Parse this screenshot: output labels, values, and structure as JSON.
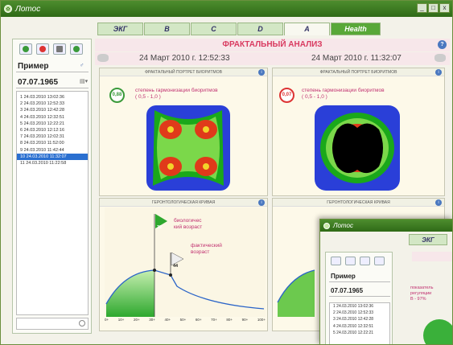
{
  "window": {
    "title": "Лотос",
    "minimize": "_",
    "maximize": "□",
    "close": "x"
  },
  "tabs": [
    "ЭКГ",
    "В",
    "С",
    "D",
    "А",
    "Health"
  ],
  "left": {
    "patient": "Пример",
    "dob": "07.07.1965",
    "records": [
      "1   24.03.2010 13:02:36",
      "2   24.03.2010 12:52:33",
      "3   24.03.2010 12:42:28",
      "4   24.03.2010 12:32:51",
      "5   24.03.2010 12:22:21",
      "6   24.03.2010 12:12:16",
      "7   24.03.2010 12:02:31",
      "8   24.03.2010 11:52:00",
      "9   24.03.2010 11:42:44",
      "10  24.03.2010 11:32:07",
      "11  24.03.2010 11:22:58"
    ],
    "selected_index": 9
  },
  "main": {
    "title": "ФРАКТАЛЬНЫЙ АНАЛИЗ",
    "date_left": "24 Март 2010 г. 12:52:33",
    "date_right": "24 Март 2010 г. 11:32:07",
    "panel_fractal_title": "ФРАКТАЛЬНЫЙ ПОРТРЕТ БИОРИТМОВ",
    "panel_curve_title": "ГЕРОНТОЛОГИЧЕСКАЯ КРИВАЯ",
    "badge_left": "0,88",
    "badge_right": "0,07",
    "harmony_text_1": "степень гармонизации биоритмов",
    "harmony_text_2": "( 0,5 - 1,0 )",
    "bio_age_label_1": "биологичес",
    "bio_age_label_2": "кий возраст",
    "bio_age_value": "32",
    "fact_age_label_1": "фактический",
    "fact_age_label_2": "возраст",
    "fact_age_value": "44",
    "x_ticks": [
      "0+",
      "10+",
      "20+",
      "30+",
      "40+",
      "50+",
      "60+",
      "70+",
      "80+",
      "90+",
      "100+"
    ]
  },
  "w2": {
    "title": "Лотос",
    "tab": "ЭКГ",
    "patient": "Пример",
    "dob": "07.07.1965",
    "records": [
      "1   24.03.2010 13:02:36",
      "2   24.03.2010 12:52:33",
      "3   24.03.2010 12:42:28",
      "4   24.03.2010 12:32:51",
      "5   24.03.2010 12:22:21"
    ],
    "side_text_1": "показатель",
    "side_text_2": "регуляции",
    "side_text_3": "В - 97%"
  },
  "colors": {
    "brand_green": "#3e7d22",
    "accent_pink": "#d93b60",
    "select_blue": "#2a6fd0"
  }
}
